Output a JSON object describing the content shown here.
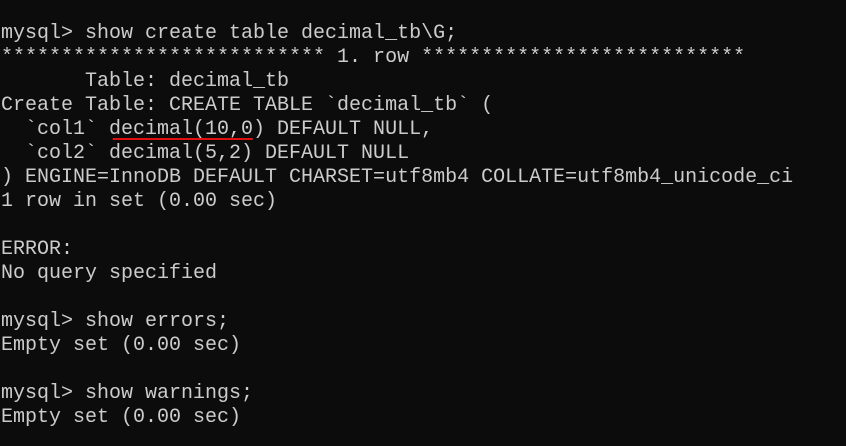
{
  "terminal": {
    "lines": [
      "mysql> show create table decimal_tb\\G;",
      "*************************** 1. row ***************************",
      "       Table: decimal_tb",
      "Create Table: CREATE TABLE `decimal_tb` (",
      "  `col1` decimal(10,0) DEFAULT NULL,",
      "  `col2` decimal(5,2) DEFAULT NULL",
      ") ENGINE=InnoDB DEFAULT CHARSET=utf8mb4 COLLATE=utf8mb4_unicode_ci",
      "1 row in set (0.00 sec)",
      "",
      "ERROR:",
      "No query specified",
      "",
      "mysql> show errors;",
      "Empty set (0.00 sec)",
      "",
      "mysql> show warnings;",
      "Empty set (0.00 sec)"
    ],
    "annotation_color": "#e01010"
  }
}
